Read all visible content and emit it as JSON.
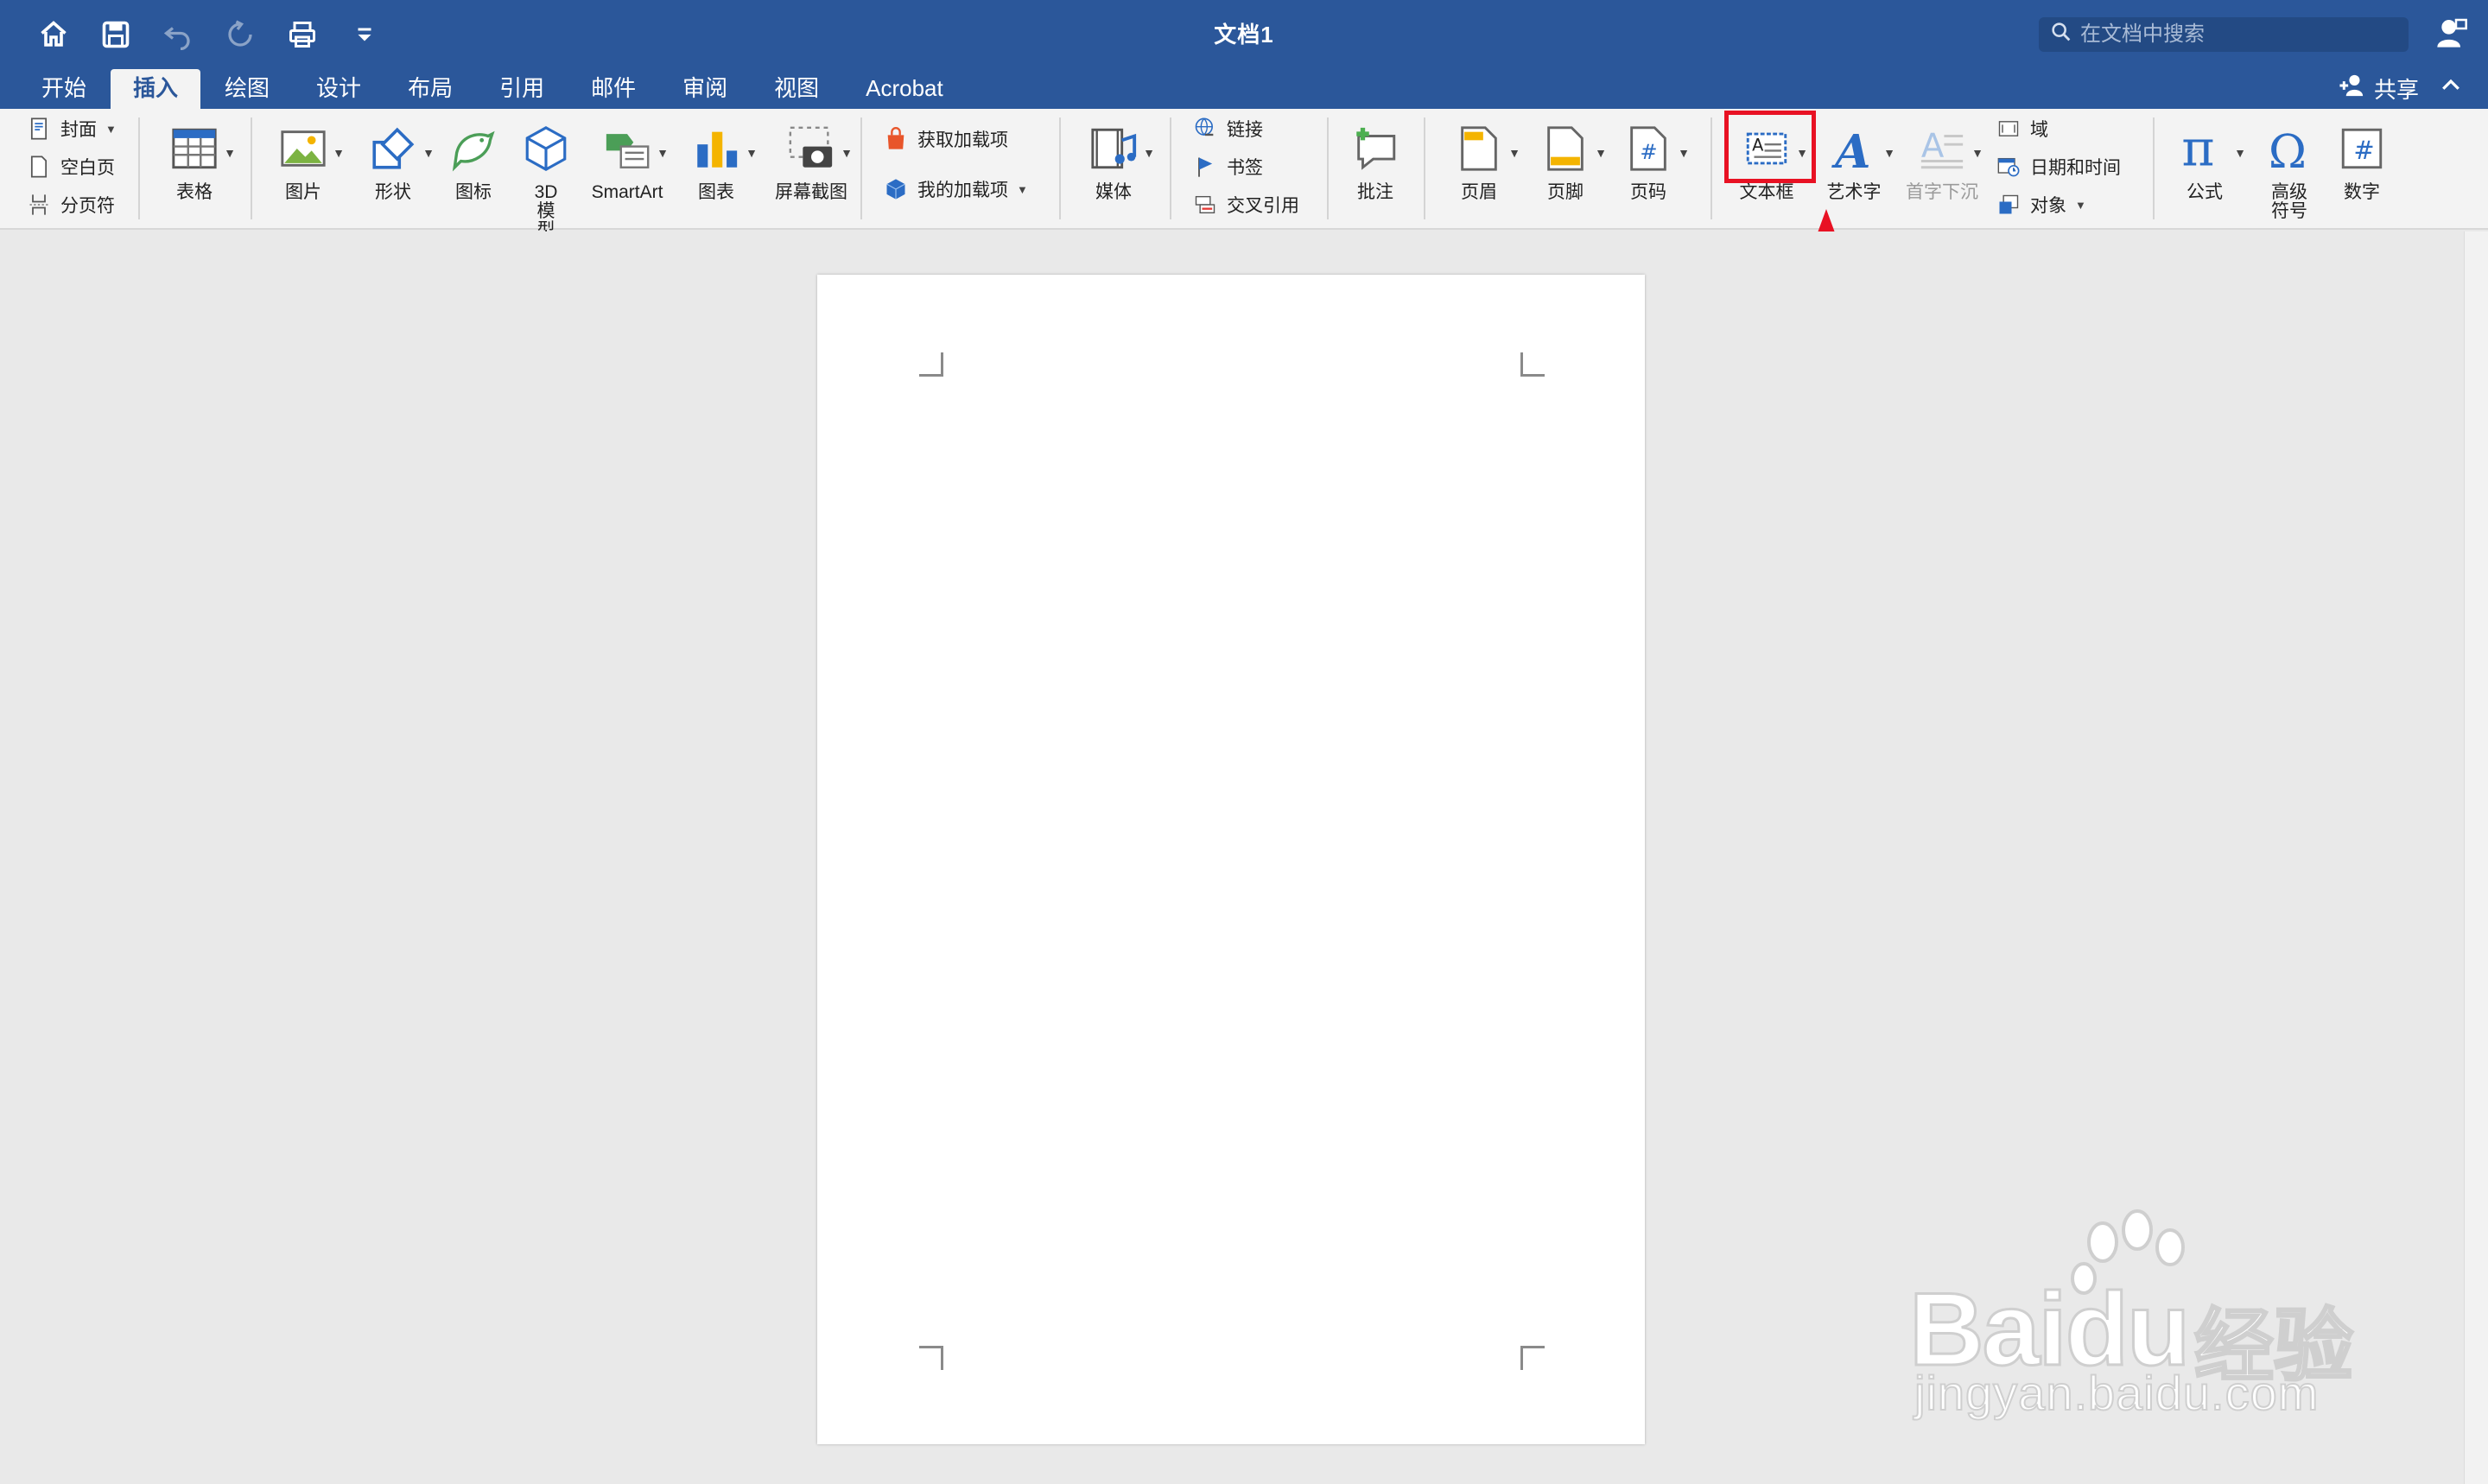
{
  "window": {
    "title": "文档1"
  },
  "search": {
    "placeholder": "在文档中搜索"
  },
  "tabs": [
    {
      "label": "开始"
    },
    {
      "label": "插入"
    },
    {
      "label": "绘图"
    },
    {
      "label": "设计"
    },
    {
      "label": "布局"
    },
    {
      "label": "引用"
    },
    {
      "label": "邮件"
    },
    {
      "label": "审阅"
    },
    {
      "label": "视图"
    },
    {
      "label": "Acrobat"
    }
  ],
  "active_tab": "插入",
  "share": {
    "label": "共享"
  },
  "ribbon": {
    "pages": {
      "cover": "封面",
      "blank": "空白页",
      "break": "分页符"
    },
    "table": "表格",
    "illustrations": {
      "picture": "图片",
      "shapes": "形状",
      "icons": "图标",
      "model3d": "3D 模型",
      "smartart": "SmartArt",
      "chart": "图表",
      "screenshot": "屏幕截图"
    },
    "addins": {
      "get": "获取加载项",
      "my": "我的加载项"
    },
    "media": "媒体",
    "links": {
      "link": "链接",
      "bookmark": "书签",
      "crossref": "交叉引用"
    },
    "comment": "批注",
    "headerfooter": {
      "header": "页眉",
      "footer": "页脚",
      "pagenum": "页码"
    },
    "text": {
      "textbox": "文本框",
      "wordart": "艺术字",
      "dropcap": "首字下沉",
      "field": "域",
      "datetime": "日期和时间",
      "object": "对象"
    },
    "symbols": {
      "equation": "公式",
      "advanced": "高级 符号",
      "number": "数字"
    }
  },
  "watermark": {
    "brand": "Baidu",
    "cn": "经验",
    "url": "jingyan.baidu.com"
  },
  "colors": {
    "title_bar": "#2b579a",
    "ribbon": "#f3f3f3",
    "highlight": "#e81123"
  }
}
